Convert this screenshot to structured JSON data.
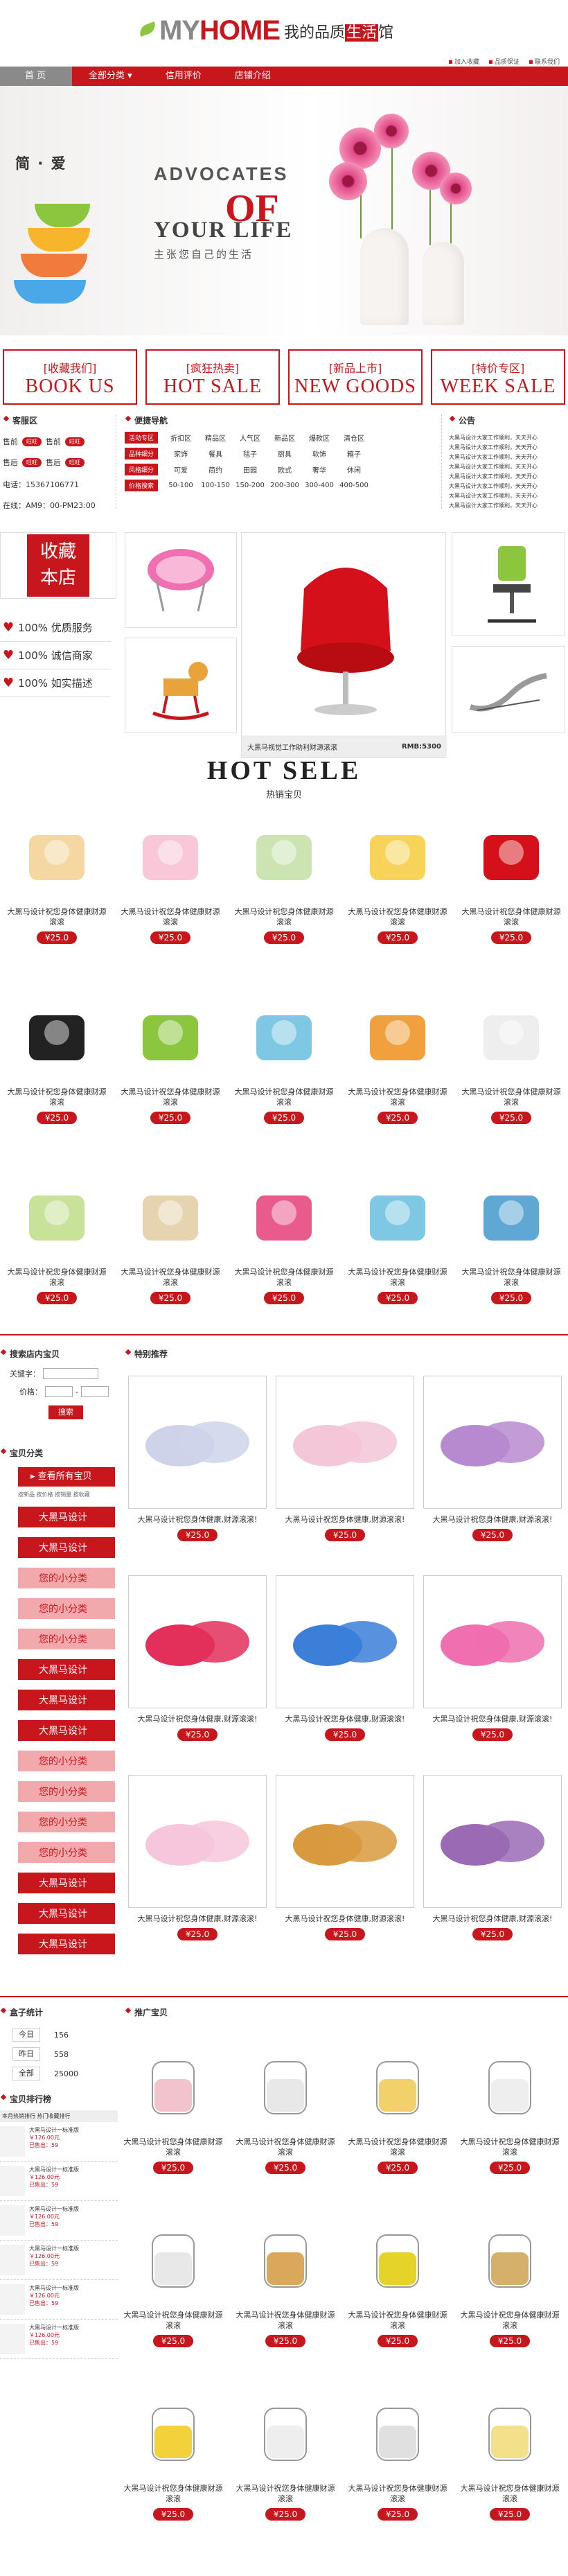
{
  "header": {
    "logo_my": "MY",
    "logo_home": "HOME",
    "slogan_a": "我的品质",
    "slogan_b": "生活",
    "slogan_c": "馆",
    "toplinks": [
      "加入收藏",
      "品质保证",
      "联系我们"
    ]
  },
  "nav": {
    "items": [
      "首  页",
      "全部分类",
      "信用评价",
      "店铺介绍"
    ]
  },
  "banner": {
    "brand": "简 · 爱",
    "advocates": "ADVOCATES",
    "of": "OF",
    "your_life": "YOUR LIFE",
    "cn": "主张您自己的生活"
  },
  "promos": [
    {
      "cn": "[收藏我们]",
      "en": "BOOK US"
    },
    {
      "cn": "[疯狂热卖]",
      "en": "HOT SALE"
    },
    {
      "cn": "[新品上市]",
      "en": "NEW GOODS"
    },
    {
      "cn": "[特价专区]",
      "en": "WEEK SALE"
    }
  ],
  "customer": {
    "title": "客服区",
    "pre": "售前",
    "post": "售后",
    "phone": "电话：15367106771",
    "time": "在线：AM9：00-PM23:00"
  },
  "quicknav": {
    "title": "便捷导航",
    "rows": [
      {
        "label": "活动专区",
        "items": [
          "折扣区",
          "精品区",
          "人气区",
          "新品区",
          "爆款区",
          "清仓区"
        ]
      },
      {
        "label": "品种细分",
        "items": [
          "家饰",
          "餐具",
          "毯子",
          "厨具",
          "软饰",
          "箱子"
        ]
      },
      {
        "label": "风格细分",
        "items": [
          "可爱",
          "简约",
          "田园",
          "欧式",
          "奢华",
          "休闲"
        ]
      },
      {
        "label": "价格搜索",
        "items": [
          "50-100",
          "100-150",
          "150-200",
          "200-300",
          "300-400",
          "400-500"
        ]
      }
    ]
  },
  "notice": {
    "title": "公告",
    "lines": [
      "大黑马设计大家工作顺利，天天开心",
      "大黑马设计大家工作顺利，天天开心",
      "大黑马设计大家工作顺利，天天开心",
      "大黑马设计大家工作顺利，天天开心",
      "大黑马设计大家工作顺利，天天开心",
      "大黑马设计大家工作顺利，天天开心",
      "大黑马设计大家工作顺利，天天开心",
      "大黑马设计大家工作顺利，天天开心"
    ]
  },
  "favorite": {
    "a": "收藏",
    "b": "本店"
  },
  "services": [
    "100% 优质服务",
    "100% 诚信商家",
    "100% 如实描述"
  ],
  "featured": {
    "caption": "大黑马视觉工作助利财源滚滚",
    "price": "RMB:5300"
  },
  "hot": {
    "title": "HOT SELE",
    "sub": "热销宝贝"
  },
  "product": {
    "text": "大黑马设计祝您身体健康财源滚滚",
    "price": "¥25.0"
  },
  "search": {
    "title": "搜索店内宝贝",
    "keyword": "关键字：",
    "price": "价格：",
    "button": "搜索"
  },
  "categories": {
    "title": "宝贝分类",
    "all": "查看所有宝贝",
    "links": "按新品  按价格  按销量  按收藏",
    "items": [
      "大黑马设计",
      "大黑马设计",
      "您的小分类",
      "您的小分类",
      "您的小分类",
      "大黑马设计",
      "大黑马设计",
      "大黑马设计",
      "您的小分类",
      "您的小分类",
      "您的小分类",
      "您的小分类",
      "大黑马设计",
      "大黑马设计",
      "大黑马设计"
    ]
  },
  "special": {
    "title": "特别推荐",
    "text": "大黑马设计祝您身体健康,财源滚滚!"
  },
  "stats": {
    "title": "盒子统计",
    "rows": [
      {
        "k": "今日",
        "v": "156"
      },
      {
        "k": "昨日",
        "v": "558"
      },
      {
        "k": "全部",
        "v": "25000"
      }
    ]
  },
  "ranking": {
    "title": "宝贝排行榜",
    "tabs": "本月热销排行  热门收藏排行",
    "items": [
      {
        "name": "大黑马设计一标准版",
        "price": "￥126.00元",
        "sold": "已售出：59"
      },
      {
        "name": "大黑马设计一标准版",
        "price": "￥126.00元",
        "sold": "已售出：59"
      },
      {
        "name": "大黑马设计一标准版",
        "price": "￥126.00元",
        "sold": "已售出：59"
      },
      {
        "name": "大黑马设计一标准版",
        "price": "￥126.00元",
        "sold": "已售出：59"
      },
      {
        "name": "大黑马设计一标准版",
        "price": "￥126.00元",
        "sold": "已售出：59"
      },
      {
        "name": "大黑马设计一标准版",
        "price": "￥126.00元",
        "sold": "已售出：59"
      }
    ]
  },
  "recommend": {
    "title": "推广宝贝",
    "text": "大黑马设计祝您身体健康财源滚滚",
    "price": "¥25.0"
  }
}
